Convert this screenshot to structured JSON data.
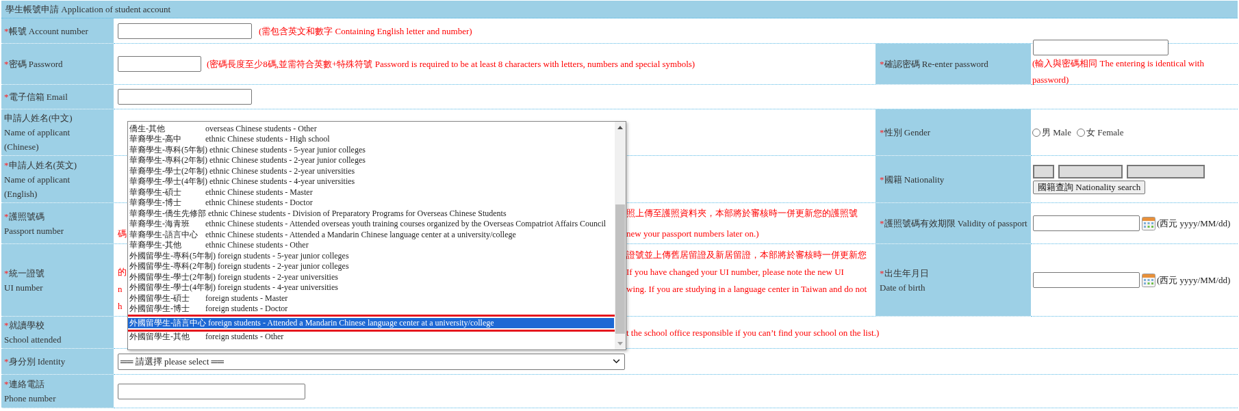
{
  "header": {
    "title": "學生帳號申請 Application of student account"
  },
  "rows": [
    {
      "label": {
        "marker": "*",
        "lines": [
          "帳號 Account number"
        ]
      },
      "value": [
        {
          "kind": "input"
        },
        {
          "kind": "note",
          "text": "(需包含英文和數字 Containing English letter and number)"
        }
      ]
    },
    {
      "label": {
        "marker": "*",
        "lines": [
          "密碼 Password"
        ]
      },
      "value": [
        {
          "kind": "input"
        },
        {
          "kind": "note",
          "text": "(密碼長度至少8碼,並需符合英數+特殊符號 Password is required to be at least 8 characters with letters, numbers and special symbols)"
        }
      ],
      "side_label": {
        "marker": "*",
        "lines": [
          "確認密碼 Re-enter password"
        ]
      },
      "side_value": [
        {
          "kind": "input"
        },
        {
          "kind": "note",
          "text": "(輸入與密碼相同 The entering is identical with password)"
        }
      ]
    },
    {
      "label": {
        "marker": "*",
        "lines": [
          "電子信箱 Email"
        ]
      },
      "value": [
        {
          "kind": "input"
        }
      ]
    },
    {
      "label": {
        "lines": [
          "申請人姓名(中文)",
          "Name of applicant",
          "(Chinese)"
        ]
      },
      "side_label": {
        "marker": "*",
        "lines": [
          "性別 Gender"
        ]
      },
      "side_value": [
        {
          "kind": "radio",
          "text": "男 Male",
          "checked": false
        },
        {
          "kind": "radio",
          "text": "女 Female",
          "checked": false
        }
      ]
    },
    {
      "label": {
        "marker": "*",
        "lines": [
          "申請人姓名(英文)",
          "Name of applicant",
          "(English)"
        ]
      },
      "side_label": {
        "marker": "*",
        "lines": [
          "國籍 Nationality"
        ]
      },
      "side_value": [
        {
          "kind": "readonly"
        },
        {
          "kind": "readonly"
        },
        {
          "kind": "readonly"
        },
        {
          "kind": "button",
          "text": "國籍查詢 Nationality search"
        }
      ]
    },
    {
      "label": {
        "marker": "*",
        "lines": [
          "護照號碼",
          "Passport number"
        ]
      },
      "value": [
        {
          "kind": "covered",
          "lines": [
            {
              "right": "照上傳至護照資料夾，本部將於審核時一併更新您的護照號"
            },
            {
              "left": "碼",
              "right": "new your passport numbers later on.)"
            }
          ]
        }
      ],
      "side_label": {
        "marker": "*",
        "lines": [
          "護照號碼有效期限 Validity of passport"
        ]
      },
      "side_value": [
        {
          "kind": "date",
          "text": "(西元 yyyy/MM/dd)"
        }
      ]
    },
    {
      "label": {
        "marker": "*",
        "lines": [
          "統一證號",
          "UI number"
        ]
      },
      "value": [
        {
          "kind": "covered",
          "lines": [
            {
              "right": "證號並上傳舊居留證及新居留證，本部將於審核時一併更新您"
            },
            {
              "left": "的",
              "right": "If you have changed your UI number, please note the new UI"
            },
            {
              "left": "n",
              "right": "wing. If you are studying in a language center in Taiwan and do not"
            },
            {
              "left": "h"
            }
          ]
        }
      ],
      "side_label": {
        "marker": "*",
        "lines": [
          "出生年月日",
          "Date of birth"
        ]
      },
      "side_value": [
        {
          "kind": "date",
          "text": "(西元 yyyy/MM/dd)"
        }
      ]
    },
    {
      "label": {
        "marker": "*",
        "lines": [
          "就讀學校",
          "School attended"
        ]
      },
      "value": [
        {
          "kind": "covered",
          "lines": [
            {
              "right": "t the school office responsible if you can’t find your school on the list.)"
            }
          ]
        }
      ]
    },
    {
      "label": {
        "marker": "*",
        "lines": [
          "身分別 Identity"
        ]
      },
      "value": [
        {
          "kind": "select",
          "text": "══ 請選擇 please select ══",
          "options": [
            {
              "chinese": "僑生-其他",
              "english": "overseas Chinese students - Other",
              "selected": false,
              "highlighted": false
            },
            {
              "chinese": "華裔學生-高中",
              "english": "ethnic Chinese students - High school",
              "selected": false,
              "highlighted": false
            },
            {
              "chinese": "華裔學生-專科(5年制)",
              "english": "ethnic Chinese students - 5-year junior colleges",
              "selected": false,
              "highlighted": false
            },
            {
              "chinese": "華裔學生-專科(2年制)",
              "english": "ethnic Chinese students - 2-year junior colleges",
              "selected": false,
              "highlighted": false
            },
            {
              "chinese": "華裔學生-學士(2年制)",
              "english": "ethnic Chinese students - 2-year universities",
              "selected": false,
              "highlighted": false
            },
            {
              "chinese": "華裔學生-學士(4年制)",
              "english": "ethnic Chinese students - 4-year universities",
              "selected": false,
              "highlighted": false
            },
            {
              "chinese": "華裔學生-碩士",
              "english": "ethnic Chinese students - Master",
              "selected": false,
              "highlighted": false
            },
            {
              "chinese": "華裔學生-博士",
              "english": "ethnic Chinese students - Doctor",
              "selected": false,
              "highlighted": false
            },
            {
              "chinese": "華裔學生-僑生先修部",
              "english": "ethnic Chinese students - Division of Preparatory Programs for Overseas Chinese Students",
              "selected": false,
              "highlighted": false
            },
            {
              "chinese": "華裔學生-海青班",
              "english": "ethnic Chinese students - Attended overseas youth training courses organized by the Overseas Compatriot Affairs Council",
              "selected": false,
              "highlighted": false
            },
            {
              "chinese": "華裔學生-語言中心",
              "english": "ethnic Chinese students - Attended a Mandarin Chinese language center at a university/college",
              "selected": false,
              "highlighted": false
            },
            {
              "chinese": "華裔學生-其他",
              "english": "ethnic Chinese students - Other",
              "selected": false,
              "highlighted": false
            },
            {
              "chinese": "外國留學生-專科(5年制)",
              "english": "foreign students - 5-year junior colleges",
              "selected": false,
              "highlighted": false
            },
            {
              "chinese": "外國留學生-專科(2年制)",
              "english": "foreign students - 2-year junior colleges",
              "selected": false,
              "highlighted": false
            },
            {
              "chinese": "外國留學生-學士(2年制)",
              "english": "foreign students - 2-year universities",
              "selected": false,
              "highlighted": false
            },
            {
              "chinese": "外國留學生-學士(4年制)",
              "english": "foreign students - 4-year universities",
              "selected": false,
              "highlighted": false
            },
            {
              "chinese": "外國留學生-碩士",
              "english": "foreign students - Master",
              "selected": false,
              "highlighted": false
            },
            {
              "chinese": "外國留學生-博士",
              "english": "foreign students - Doctor",
              "selected": false,
              "highlighted": false
            },
            {
              "chinese": "外國留學生-語言中心",
              "english": "foreign students - Attended a Mandarin Chinese language center at a university/college",
              "selected": true,
              "highlighted": true
            },
            {
              "chinese": "外國留學生-其他",
              "english": "foreign students - Other",
              "selected": false,
              "highlighted": false
            }
          ]
        }
      ]
    },
    {
      "label": {
        "marker": "*",
        "lines": [
          "連絡電話",
          "Phone number"
        ]
      },
      "value": [
        {
          "kind": "input"
        }
      ]
    }
  ]
}
